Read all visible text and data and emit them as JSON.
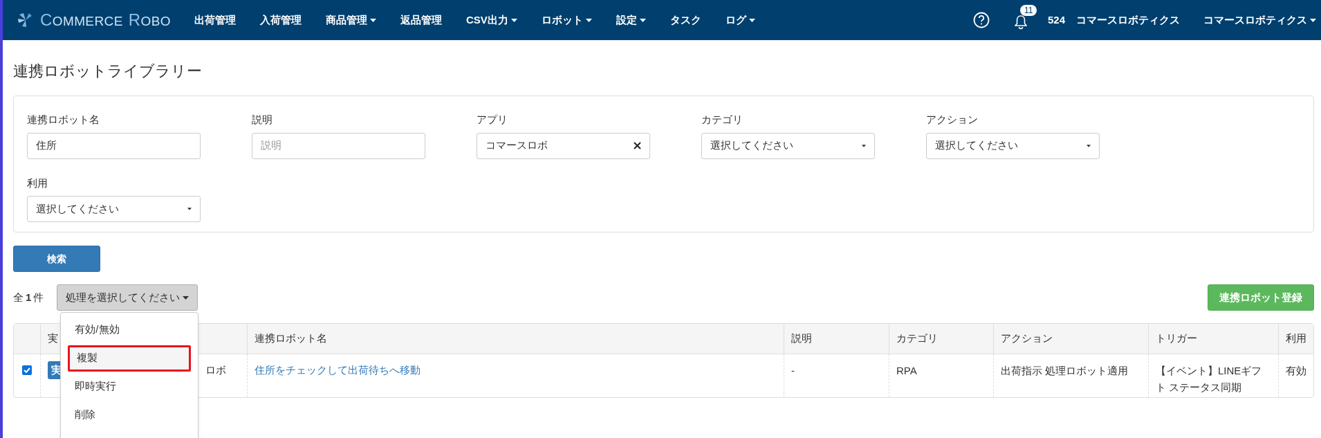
{
  "header": {
    "logo": "COMMERCE ROBO",
    "nav": [
      {
        "label": "出荷管理",
        "has_menu": false
      },
      {
        "label": "入荷管理",
        "has_menu": false
      },
      {
        "label": "商品管理",
        "has_menu": true
      },
      {
        "label": "返品管理",
        "has_menu": false
      },
      {
        "label": "CSV出力",
        "has_menu": true
      },
      {
        "label": "ロボット",
        "has_menu": true
      },
      {
        "label": "設定",
        "has_menu": true
      },
      {
        "label": "タスク",
        "has_menu": false
      },
      {
        "label": "ログ",
        "has_menu": true
      }
    ],
    "notification_count": "11",
    "user_id": "524",
    "company": "コマースロボティクス",
    "account_menu": "コマースロボティクス"
  },
  "page_title": "連携ロボットライブラリー",
  "filters": [
    {
      "label": "連携ロボット名",
      "kind": "text",
      "value": "住所"
    },
    {
      "label": "説明",
      "kind": "text",
      "placeholder": "説明"
    },
    {
      "label": "アプリ",
      "kind": "clearable",
      "value": "コマースロボ"
    },
    {
      "label": "カテゴリ",
      "kind": "select",
      "value": "選択してください"
    },
    {
      "label": "アクション",
      "kind": "select",
      "value": "選択してください"
    },
    {
      "label": "利用",
      "kind": "select",
      "value": "選択してください"
    }
  ],
  "search_button": "検索",
  "count": {
    "prefix": "全",
    "number": "1",
    "suffix": "件"
  },
  "bulk_action": {
    "label": "処理を選択してください",
    "expanded": true,
    "options": [
      {
        "label": "有効/無効",
        "selected": false
      },
      {
        "label": "複製",
        "selected": true
      },
      {
        "label": "即時実行",
        "selected": false
      },
      {
        "label": "削除",
        "selected": false
      }
    ]
  },
  "register_button": "連携ロボット登録",
  "table": {
    "columns": [
      "",
      "実",
      "",
      "連携ロボット名",
      "説明",
      "カテゴリ",
      "アクション",
      "トリガー",
      "利用"
    ],
    "rows": [
      {
        "checked": true,
        "run_button": "実",
        "app": "ロボ",
        "name": "住所をチェックして出荷待ちへ移動",
        "description": "-",
        "category": "RPA",
        "action": "出荷指示 処理ロボット適用",
        "trigger": "【イベント】LINEギフト ステータス同期",
        "usage": "有効"
      }
    ]
  }
}
